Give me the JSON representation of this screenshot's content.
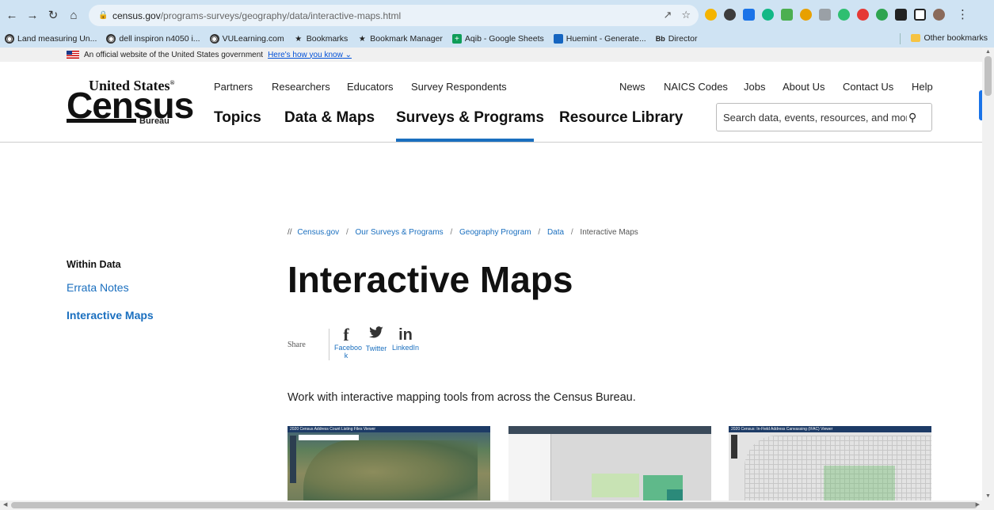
{
  "browser": {
    "url_host": "census.gov",
    "url_path": "/programs-surveys/geography/data/interactive-maps.html",
    "bookmarks": [
      {
        "label": "Land measuring Un...",
        "icon": "globe-icon"
      },
      {
        "label": "dell inspiron n4050 i...",
        "icon": "globe-icon"
      },
      {
        "label": "VULearning.com",
        "icon": "globe-icon"
      },
      {
        "label": "Bookmarks",
        "icon": "star-icon"
      },
      {
        "label": "Bookmark Manager",
        "icon": "star-icon"
      },
      {
        "label": "Aqib - Google Sheets",
        "icon": "sheets-icon"
      },
      {
        "label": "Huemint - Generate...",
        "icon": "huemint-icon"
      },
      {
        "label": "Director",
        "icon": "blackboard-icon"
      }
    ],
    "other_bookmarks": "Other bookmarks",
    "extension_colors": [
      "#f4b400",
      "#3c3c3c",
      "#1a73e8",
      "#12b886",
      "#4caf50",
      "#e8a000",
      "#9aa0a6",
      "#2fbf71",
      "#e53935",
      "#2ea44f",
      "#222222",
      "#222222"
    ]
  },
  "gov_banner": {
    "text": "An official website of the United States government",
    "link": "Here's how you know"
  },
  "logo": {
    "top": "United States",
    "main": "Census",
    "bottom": "Bureau"
  },
  "subnav": [
    "Partners",
    "Researchers",
    "Educators",
    "Survey Respondents"
  ],
  "utility_nav": [
    "News",
    "NAICS Codes",
    "Jobs",
    "About Us",
    "Contact Us",
    "Help"
  ],
  "mainnav": [
    "Topics",
    "Data & Maps",
    "Surveys & Programs",
    "Resource Library"
  ],
  "active_nav": "Surveys & Programs",
  "search": {
    "placeholder": "Search data, events, resources, and more"
  },
  "breadcrumb": {
    "prefix": "//",
    "links": [
      "Census.gov",
      "Our Surveys & Programs",
      "Geography Program",
      "Data"
    ],
    "current": "Interactive Maps"
  },
  "sidebar": {
    "title": "Within Data",
    "items": [
      {
        "label": "Errata Notes"
      },
      {
        "label": "Interactive Maps"
      }
    ]
  },
  "page_title": "Interactive Maps",
  "share": {
    "label": "Share",
    "items": [
      {
        "glyph": "f",
        "label": "Faceboo k"
      },
      {
        "glyph": "t",
        "label": "Twitter"
      },
      {
        "glyph": "in",
        "label": "LinkedIn"
      }
    ]
  },
  "intro": "Work with interactive mapping tools from across the Census Bureau.",
  "thumbnails": [
    {
      "title": "2020 Census Address Count Listing Files Viewer"
    },
    {
      "title": ""
    },
    {
      "title": "2020 Census: In-Field Address Canvassing (IFAC) Viewer"
    }
  ]
}
